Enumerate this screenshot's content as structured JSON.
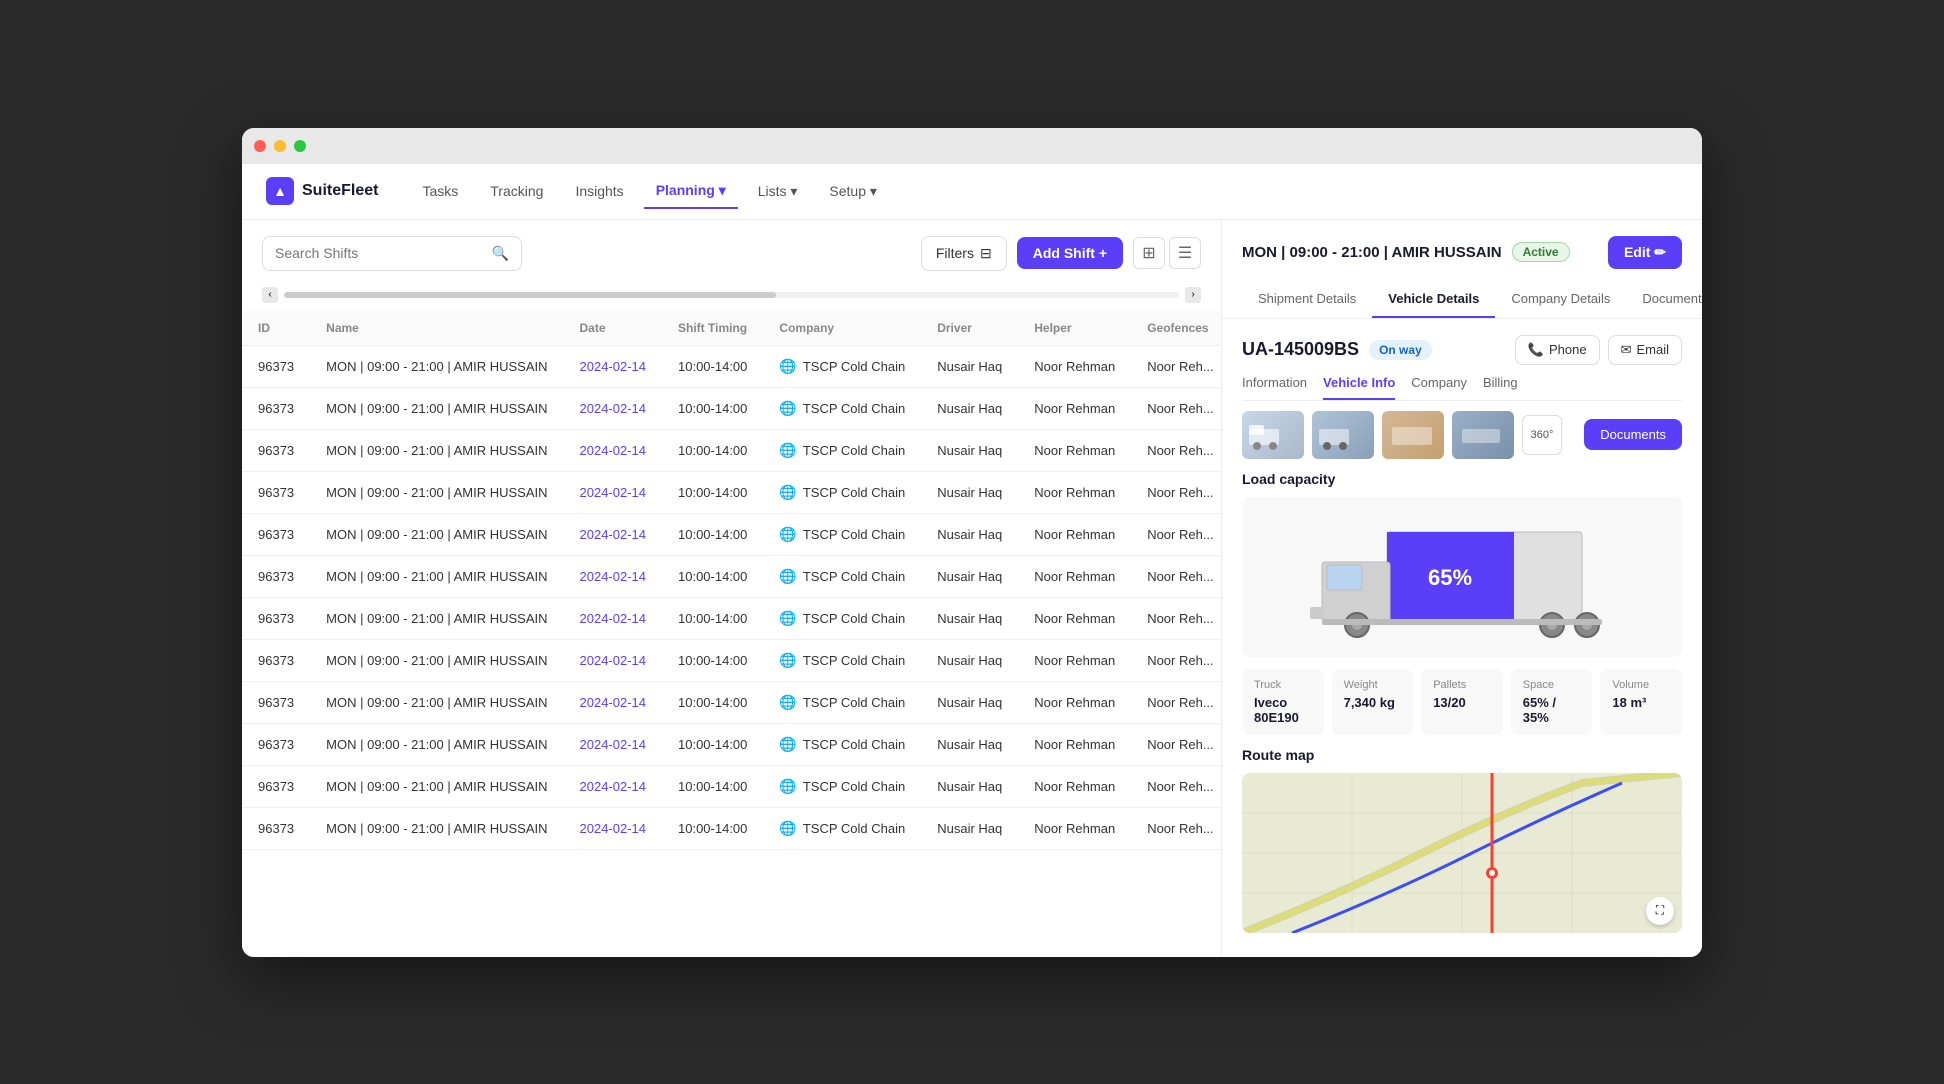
{
  "window": {
    "title": "SuiteFleet"
  },
  "logo": {
    "text": "SuiteFleet",
    "icon": "▲"
  },
  "nav": {
    "items": [
      {
        "label": "Tasks",
        "active": false
      },
      {
        "label": "Tracking",
        "active": false
      },
      {
        "label": "Insights",
        "active": false
      },
      {
        "label": "Planning ▾",
        "active": true
      },
      {
        "label": "Lists ▾",
        "active": false
      },
      {
        "label": "Setup ▾",
        "active": false
      }
    ]
  },
  "toolbar": {
    "search_placeholder": "Search Shifts",
    "filter_label": "Filters",
    "add_shift_label": "Add Shift +"
  },
  "table": {
    "columns": [
      "ID",
      "Name",
      "Date",
      "Shift Timing",
      "Company",
      "Driver",
      "Helper",
      "Geofences"
    ],
    "rows": [
      {
        "id": "96373",
        "name": "MON | 09:00 - 21:00 | AMIR HUSSAIN",
        "date": "2024-02-14",
        "timing": "10:00-14:00",
        "company": "TSCP Cold Chain",
        "driver": "Nusair Haq",
        "helper": "Noor Rehman",
        "geo": "Noor Reh..."
      },
      {
        "id": "96373",
        "name": "MON | 09:00 - 21:00 | AMIR HUSSAIN",
        "date": "2024-02-14",
        "timing": "10:00-14:00",
        "company": "TSCP Cold Chain",
        "driver": "Nusair Haq",
        "helper": "Noor Rehman",
        "geo": "Noor Reh..."
      },
      {
        "id": "96373",
        "name": "MON | 09:00 - 21:00 | AMIR HUSSAIN",
        "date": "2024-02-14",
        "timing": "10:00-14:00",
        "company": "TSCP Cold Chain",
        "driver": "Nusair Haq",
        "helper": "Noor Rehman",
        "geo": "Noor Reh..."
      },
      {
        "id": "96373",
        "name": "MON | 09:00 - 21:00 | AMIR HUSSAIN",
        "date": "2024-02-14",
        "timing": "10:00-14:00",
        "company": "TSCP Cold Chain",
        "driver": "Nusair Haq",
        "helper": "Noor Rehman",
        "geo": "Noor Reh..."
      },
      {
        "id": "96373",
        "name": "MON | 09:00 - 21:00 | AMIR HUSSAIN",
        "date": "2024-02-14",
        "timing": "10:00-14:00",
        "company": "TSCP Cold Chain",
        "driver": "Nusair Haq",
        "helper": "Noor Rehman",
        "geo": "Noor Reh..."
      },
      {
        "id": "96373",
        "name": "MON | 09:00 - 21:00 | AMIR HUSSAIN",
        "date": "2024-02-14",
        "timing": "10:00-14:00",
        "company": "TSCP Cold Chain",
        "driver": "Nusair Haq",
        "helper": "Noor Rehman",
        "geo": "Noor Reh..."
      },
      {
        "id": "96373",
        "name": "MON | 09:00 - 21:00 | AMIR HUSSAIN",
        "date": "2024-02-14",
        "timing": "10:00-14:00",
        "company": "TSCP Cold Chain",
        "driver": "Nusair Haq",
        "helper": "Noor Rehman",
        "geo": "Noor Reh..."
      },
      {
        "id": "96373",
        "name": "MON | 09:00 - 21:00 | AMIR HUSSAIN",
        "date": "2024-02-14",
        "timing": "10:00-14:00",
        "company": "TSCP Cold Chain",
        "driver": "Nusair Haq",
        "helper": "Noor Rehman",
        "geo": "Noor Reh..."
      },
      {
        "id": "96373",
        "name": "MON | 09:00 - 21:00 | AMIR HUSSAIN",
        "date": "2024-02-14",
        "timing": "10:00-14:00",
        "company": "TSCP Cold Chain",
        "driver": "Nusair Haq",
        "helper": "Noor Rehman",
        "geo": "Noor Reh..."
      },
      {
        "id": "96373",
        "name": "MON | 09:00 - 21:00 | AMIR HUSSAIN",
        "date": "2024-02-14",
        "timing": "10:00-14:00",
        "company": "TSCP Cold Chain",
        "driver": "Nusair Haq",
        "helper": "Noor Rehman",
        "geo": "Noor Reh..."
      },
      {
        "id": "96373",
        "name": "MON | 09:00 - 21:00 | AMIR HUSSAIN",
        "date": "2024-02-14",
        "timing": "10:00-14:00",
        "company": "TSCP Cold Chain",
        "driver": "Nusair Haq",
        "helper": "Noor Rehman",
        "geo": "Noor Reh..."
      },
      {
        "id": "96373",
        "name": "MON | 09:00 - 21:00 | AMIR HUSSAIN",
        "date": "2024-02-14",
        "timing": "10:00-14:00",
        "company": "TSCP Cold Chain",
        "driver": "Nusair Haq",
        "helper": "Noor Rehman",
        "geo": "Noor Reh..."
      }
    ]
  },
  "right_panel": {
    "shift_info": "MON | 09:00 - 21:00 | AMIR HUSSAIN",
    "status": "Active",
    "edit_label": "Edit ✏",
    "detail_tabs": [
      "Shipment Details",
      "Vehicle Details",
      "Company Details",
      "Documents"
    ],
    "active_detail_tab": "Vehicle Details",
    "vehicle": {
      "id": "UA-145009BS",
      "status": "On way",
      "phone_label": "Phone",
      "email_label": "Email",
      "sub_tabs": [
        "Information",
        "Vehicle Info",
        "Company",
        "Billing"
      ],
      "active_sub_tab": "Vehicle Info",
      "documents_label": "Documents",
      "load_capacity_label": "Load capacity",
      "capacity_pct": "65%",
      "truck_label": "Truck",
      "truck_value": "Iveco 80E190",
      "weight_label": "Weight",
      "weight_value": "7,340 kg",
      "pallets_label": "Pallets",
      "pallets_value": "13/20",
      "space_label": "Space",
      "space_value": "65% / 35%",
      "volume_label": "Volume",
      "volume_value": "18 m³",
      "route_map_label": "Route map"
    },
    "phone_icon": "📞",
    "email_icon": "✉"
  },
  "colors": {
    "accent": "#5b3ff8",
    "active_badge_bg": "#e8f5e9",
    "active_badge_text": "#2e7d32",
    "on_way_bg": "#e3f2fd",
    "on_way_text": "#1565c0"
  }
}
